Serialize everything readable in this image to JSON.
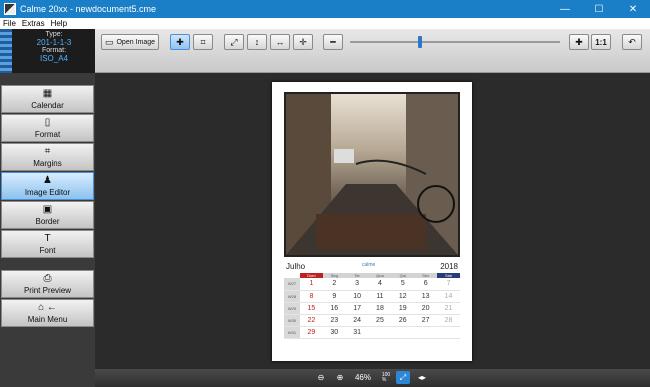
{
  "window": {
    "title": "Calme 20xx - newdocument5.cme",
    "min": "—",
    "max": "☐",
    "close": "✕"
  },
  "menu": [
    "File",
    "Extras",
    "Help"
  ],
  "info": {
    "type_label": "Type:",
    "type_value": "201-1-1-3",
    "format_label": "Format:",
    "format_value": "ISO_A4"
  },
  "toolbar": {
    "open_image": "Open Image",
    "one_to_one": "1:1",
    "zoom_level": 0.33
  },
  "sidebar": [
    {
      "label": "Calendar",
      "icon": "calendar-icon"
    },
    {
      "label": "Format",
      "icon": "format-icon"
    },
    {
      "label": "Margins",
      "icon": "margins-icon"
    },
    {
      "label": "Image Editor",
      "icon": "person-icon"
    },
    {
      "label": "Border",
      "icon": "border-icon"
    },
    {
      "label": "Font",
      "icon": "font-icon"
    },
    {
      "label": "Print Preview",
      "icon": "printer-icon"
    },
    {
      "label": "Main Menu",
      "icon": "home-icon"
    }
  ],
  "calendar": {
    "month": "Julho",
    "year": "2018",
    "logo": "calme",
    "days": [
      "Dom",
      "Seg",
      "Ter",
      "Qua",
      "Qui",
      "Sex",
      "Sáb"
    ],
    "weeks": [
      {
        "wk": "W27",
        "d": [
          "1",
          "2",
          "3",
          "4",
          "5",
          "6",
          "7"
        ]
      },
      {
        "wk": "W28",
        "d": [
          "8",
          "9",
          "10",
          "11",
          "12",
          "13",
          "14"
        ]
      },
      {
        "wk": "W29",
        "d": [
          "15",
          "16",
          "17",
          "18",
          "19",
          "20",
          "21"
        ]
      },
      {
        "wk": "W30",
        "d": [
          "22",
          "23",
          "24",
          "25",
          "26",
          "27",
          "28"
        ]
      },
      {
        "wk": "W31",
        "d": [
          "29",
          "30",
          "31",
          "",
          "",
          "",
          ""
        ]
      }
    ]
  },
  "statusbar": {
    "zoom_percent": "46%",
    "fit_label": "100\n%"
  }
}
